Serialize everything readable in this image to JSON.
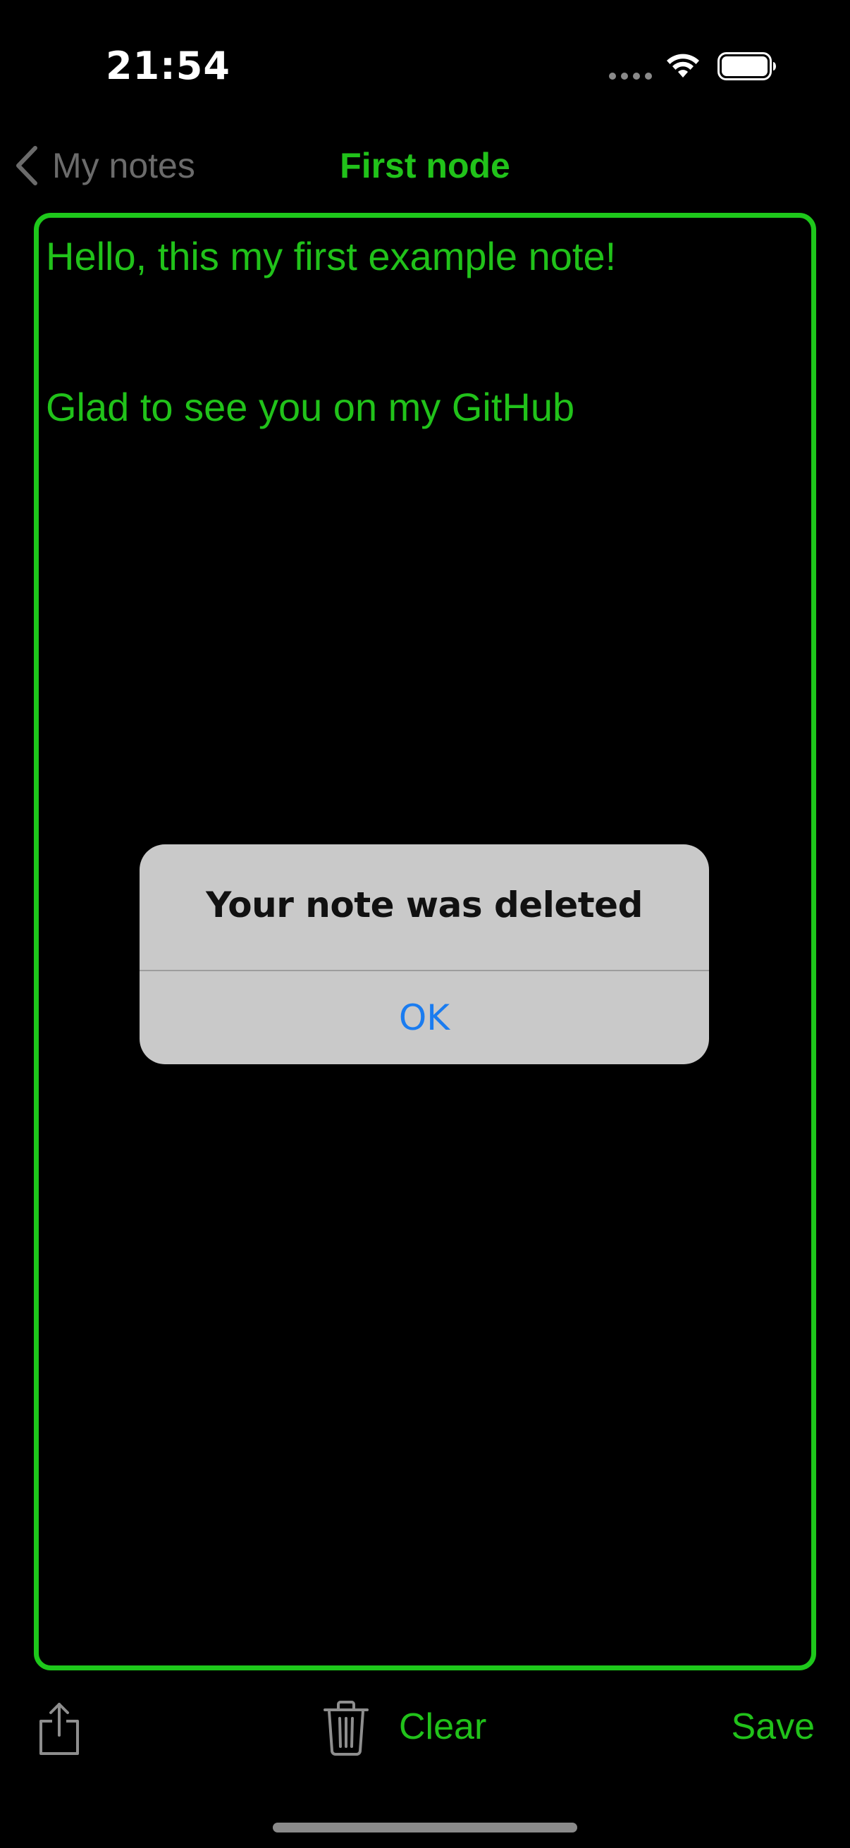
{
  "status_bar": {
    "time": "21:54"
  },
  "nav": {
    "back_label": "My notes",
    "title": "First node"
  },
  "note": {
    "lines": [
      "Hello, this my first example note!",
      "Glad to see you on my GitHub"
    ]
  },
  "alert": {
    "title": "Your note was deleted",
    "ok_label": "OK"
  },
  "toolbar": {
    "clear_label": "Clear",
    "save_label": "Save"
  },
  "icons": {
    "back": "chevron-left-icon",
    "share": "share-icon",
    "trash": "trash-icon",
    "wifi": "wifi-icon",
    "battery": "battery-icon",
    "signal": "signal-icon"
  },
  "colors": {
    "accent_green": "#21c21a",
    "alert_button_blue": "#1a7cf0",
    "background": "#000000"
  }
}
